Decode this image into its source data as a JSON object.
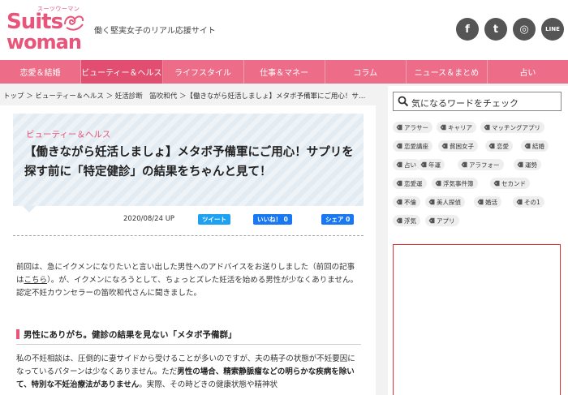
{
  "header": {
    "logo_kana": "スーツウーマン",
    "logo_line1": "Suits",
    "logo_line2": "woman",
    "tagline": "働く堅実女子のリアル応援サイト",
    "social": {
      "facebook": "f",
      "twitter": "t",
      "instagram": "◎",
      "line": "LINE"
    }
  },
  "nav": {
    "items": [
      "恋愛＆結婚",
      "ビューティー＆ヘルス",
      "ライフスタイル",
      "仕事＆マネー",
      "コラム",
      "ニュース＆まとめ",
      "占い"
    ]
  },
  "breadcrumb": "トップ ＞ ビューティー＆ヘルス ＞ 妊活診断　笛吹和代 ＞【働きながら妊活しましょ】メタボ予備軍にご用心！サ…",
  "article": {
    "category": "ビューティー＆ヘルス",
    "title": "【働きながら妊活しましょ】メタボ予備軍にご用心！サプリを探す前に「特定健診」の結果をちゃんと見て！",
    "date": "2020/08/24 UP",
    "share": {
      "tweet": "ツイート",
      "like": "いいね！ 0",
      "fb_share": "シェア 0"
    },
    "para1_a": "前回は、急にイクメンになりたいと言い出した男性へのアドバイスをお送りしました（前回の記事は",
    "para1_link": "こちら",
    "para1_b": "）。が、イクメンになろうとして、ちょっとズレた妊活を始める男性が少なくありません。認定不妊カウンセラーの笛吹和代さんに聞きました。",
    "subheading": "男性にありがち。健診の結果を見ない「メタボ予備群」",
    "para2_a": "私の不妊相談は、圧倒的に妻サイドから受けることが多いのですが、夫の精子の状態が不妊要因になっているパターンは少なくありません。ただ",
    "para2_bold": "男性の場合、精索静脈瘤などの明らかな疾病を除いて、特別な不妊治療法がありません",
    "para2_b": "。実際、その時どきの健康状態や精神状"
  },
  "sidebar": {
    "search_placeholder": "気になるワードをチェック",
    "tags": [
      "アラサー",
      "キャリア",
      "マッチングアプリ",
      "恋愛講座",
      "貧困女子",
      "恋愛",
      "結婚",
      "占い",
      "年運",
      "アラフォー",
      "運勢",
      "恋愛運",
      "浮気事件簿",
      "セカンド",
      "不倫",
      "美人探偵",
      "婚活",
      "その1",
      "浮気",
      "アプリ"
    ]
  },
  "colors": {
    "brand_pink": "#e8547a",
    "nav_pink": "#ed6c87",
    "twitter_blue": "#1da1f2",
    "facebook_blue": "#1877f2"
  }
}
